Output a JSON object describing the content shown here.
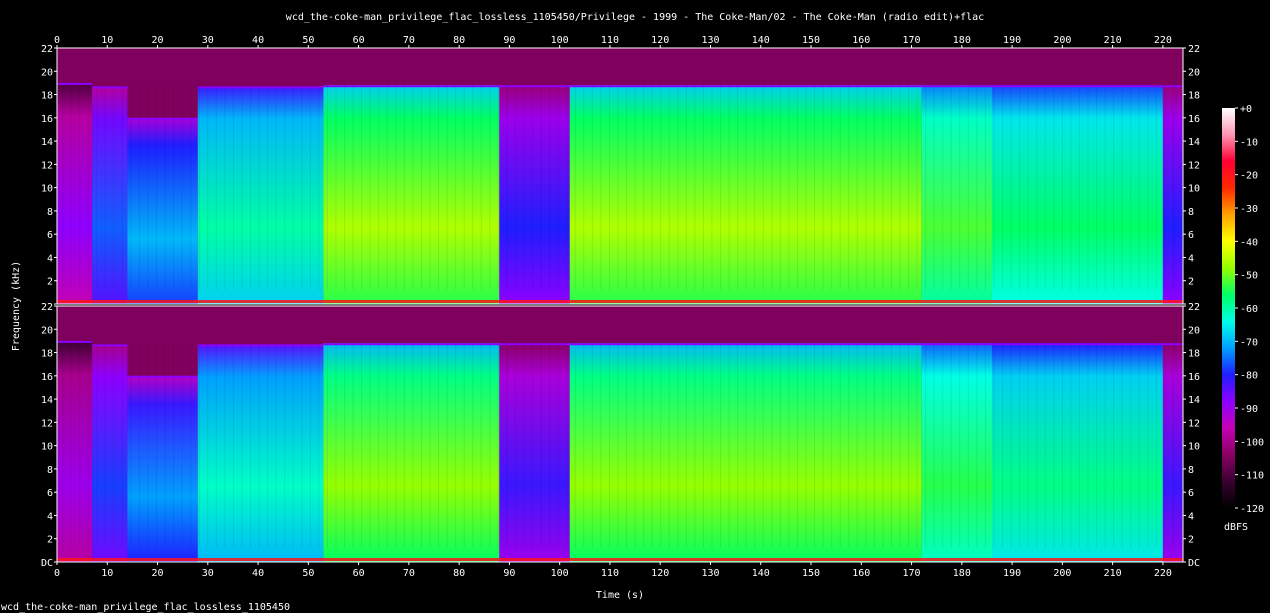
{
  "title": "wcd_the-coke-man_privilege_flac_lossless_1105450/Privilege - 1999 - The Coke-Man/02 - The Coke-Man (radio edit)+flac",
  "footer": "wcd_the-coke-man_privilege_flac_lossless_1105450",
  "colors": {
    "background": "#000000",
    "text": "#ffffff",
    "scale": [
      "#000000",
      "#3a0030",
      "#8a0064",
      "#c400b4",
      "#8e00ff",
      "#1e1eff",
      "#00a0ff",
      "#00ffe6",
      "#00ff64",
      "#96ff00",
      "#ffff00",
      "#ffa000",
      "#ff2800",
      "#ff0032",
      "#ff96b4",
      "#ffffff"
    ]
  },
  "chart_data": {
    "type": "heatmap",
    "xlabel": "Time (s)",
    "ylabel": "Frequency (kHz)",
    "xlim": [
      0,
      224
    ],
    "ylim": [
      0,
      22
    ],
    "x_ticks": [
      0,
      10,
      20,
      30,
      40,
      50,
      60,
      70,
      80,
      90,
      100,
      110,
      120,
      130,
      140,
      150,
      160,
      170,
      180,
      190,
      200,
      210,
      220
    ],
    "y_ticks": [
      "DC",
      "2",
      "4",
      "6",
      "8",
      "10",
      "12",
      "14",
      "16",
      "18",
      "20",
      "22"
    ],
    "channels": 2,
    "colorbar": {
      "label": "dBFS",
      "range": [
        -120,
        0
      ],
      "ticks": [
        "+0",
        "-10",
        "-20",
        "-30",
        "-40",
        "-50",
        "-60",
        "-70",
        "-80",
        "-90",
        "-100",
        "-110",
        "-120"
      ]
    },
    "cutoff_khz": 19,
    "segments": [
      {
        "start": 0,
        "end": 7,
        "level": -88,
        "cutoff": 19
      },
      {
        "start": 7,
        "end": 14,
        "level": -76,
        "cutoff": 18.7
      },
      {
        "start": 14,
        "end": 28,
        "level": -70,
        "cutoff": 16
      },
      {
        "start": 28,
        "end": 53,
        "level": -60,
        "cutoff": 18.7
      },
      {
        "start": 53,
        "end": 88,
        "level": -46,
        "cutoff": 18.8
      },
      {
        "start": 88,
        "end": 102,
        "level": -80,
        "cutoff": 18.8
      },
      {
        "start": 102,
        "end": 172,
        "level": -46,
        "cutoff": 18.8
      },
      {
        "start": 172,
        "end": 186,
        "level": -52,
        "cutoff": 18.8
      },
      {
        "start": 186,
        "end": 220,
        "level": -56,
        "cutoff": 18.8
      },
      {
        "start": 220,
        "end": 224,
        "level": -80,
        "cutoff": 18.8
      }
    ]
  }
}
